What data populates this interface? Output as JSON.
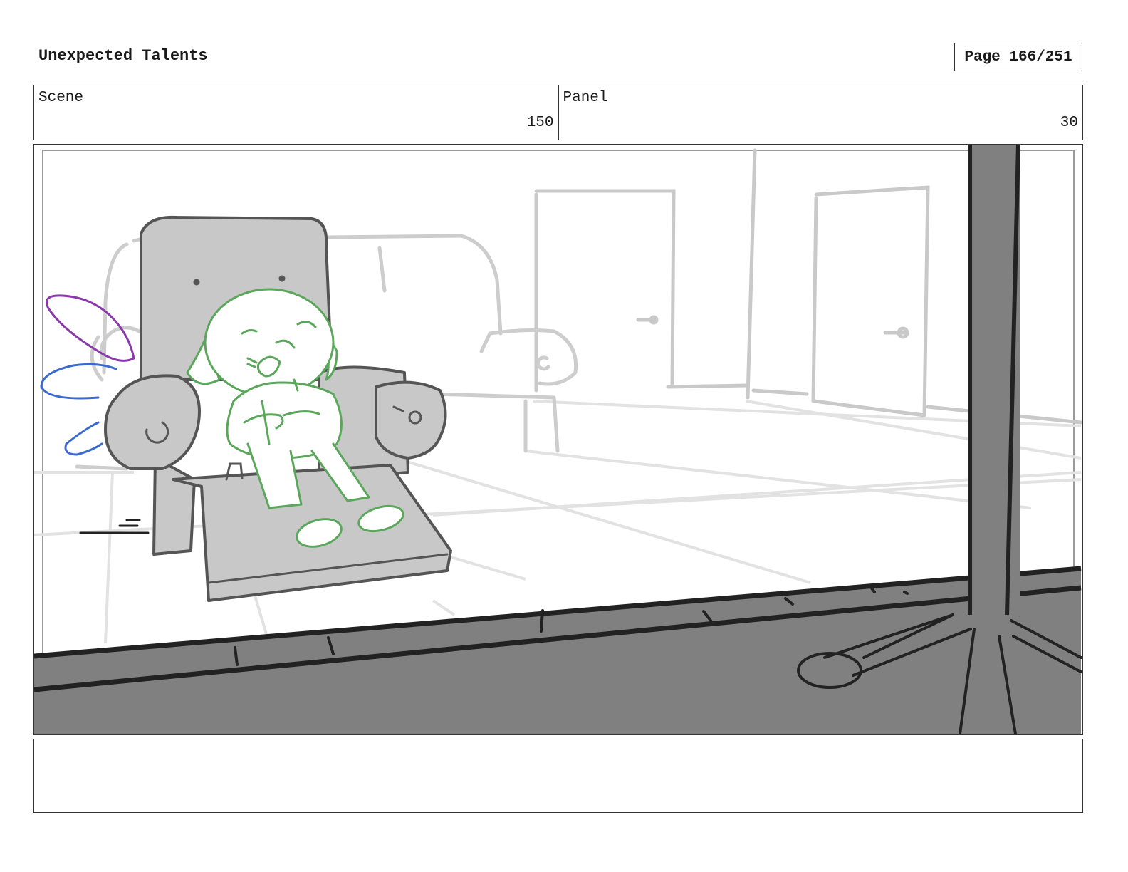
{
  "header": {
    "title": "Unexpected Talents",
    "page_label": "Page 166/251"
  },
  "scene": {
    "label": "Scene",
    "value": "150"
  },
  "panel": {
    "label": "Panel",
    "value": "30"
  },
  "notes": {
    "text": ""
  },
  "colors": {
    "character_line": "#5aa65a",
    "wing_purple": "#8a3aa8",
    "wing_blue": "#3a6ad0",
    "chair_fill": "#c8c8c8",
    "window_frame": "#808080"
  }
}
